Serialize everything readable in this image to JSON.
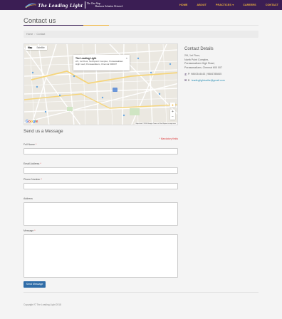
{
  "header": {
    "logo_text": "The Leading Light",
    "tagline_line1": "The One Stop",
    "tagline_line2": "Business Solution Network",
    "nav": [
      {
        "label": "HOME"
      },
      {
        "label": "ABOUT"
      },
      {
        "label": "PRACTICES"
      },
      {
        "label": "CAREERS"
      },
      {
        "label": "CONTACT"
      }
    ],
    "practices_caret_icon": "chevron-down-icon",
    "colors": {
      "bar": "#3b1e54",
      "nav_text": "#f0b43c"
    }
  },
  "page": {
    "title": "Contact us",
    "breadcrumb": [
      "Home",
      "Contact"
    ]
  },
  "map": {
    "tab_map": "Map",
    "tab_satellite": "Satellite",
    "info_title": "The Leading Light",
    "info_address": "2/2, 1st Floor, Northpoint Complex, Purasawalkam High road, Purasawalkam, Chennai 600007",
    "close_icon": "close-icon",
    "zoom_in": "+",
    "zoom_out": "−",
    "google_logo": "Google",
    "footer_text": "Map data ©2018 Google   Terms of Use   Report a map error"
  },
  "contact": {
    "title": "Contact Details",
    "address_lines": [
      "2/6, 1st Floor,",
      "North Point Complex,",
      "Purasawalkam High Road,",
      "Purasawalkam, Chennai 600 007"
    ],
    "phone_label": "P:",
    "phone": "9840344443 | 9884785845",
    "email_label": "E:",
    "email": "leadinglightsathe@gmail.com"
  },
  "form": {
    "title": "Send us a Message",
    "mandatory_note": "* Mandatory fields",
    "fields": [
      {
        "label": "Full Name",
        "required": "*"
      },
      {
        "label": "Email Address",
        "required": "*"
      },
      {
        "label": "Phone Number",
        "required": "*"
      },
      {
        "label": "Address",
        "required": ""
      },
      {
        "label": "Message",
        "required": "*"
      }
    ],
    "submit_label": "Send Message"
  },
  "footer": {
    "copyright": "Copyright © The Leading Light 2018"
  }
}
